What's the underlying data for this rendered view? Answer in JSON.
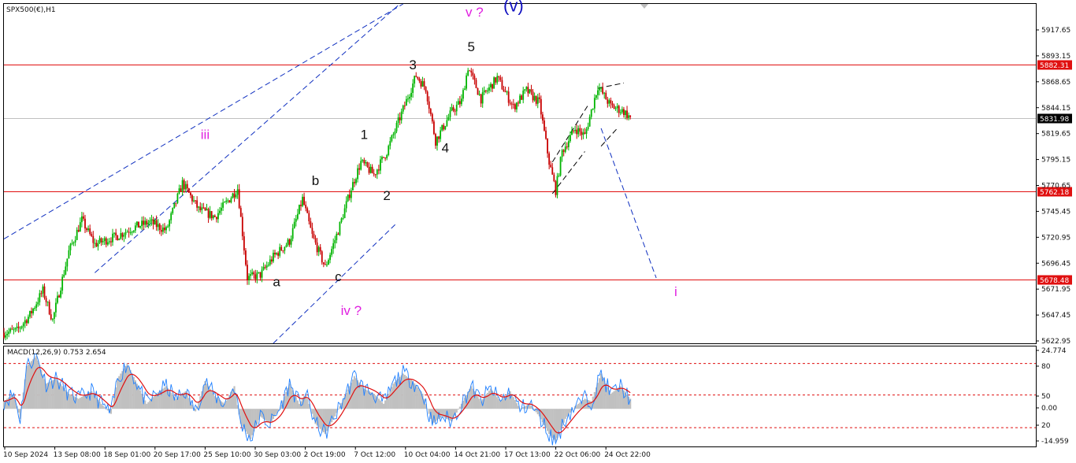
{
  "chart_data": [
    {
      "type": "candlestick",
      "title": "SPX500(€),H1",
      "y_ticks": [
        "5917.65",
        "5893.15",
        "5868.65",
        "5844.15",
        "5819.65",
        "5795.15",
        "5770.65",
        "5745.45",
        "5720.95",
        "5696.45",
        "5671.95",
        "5647.45",
        "5622.95"
      ],
      "ylim": [
        5618.0,
        5940.0
      ],
      "x_ticks": [
        "10 Sep 2024",
        "13 Sep 08:00",
        "18 Sep 01:00",
        "20 Sep 17:00",
        "25 Sep 10:00",
        "30 Sep 03:00",
        "2 Oct 19:00",
        "7 Oct 12:00",
        "10 Oct 04:00",
        "14 Oct 21:00",
        "17 Oct 13:00",
        "22 Oct 06:00",
        "24 Oct 22:00"
      ],
      "horizontal_levels": [
        {
          "value": 5882.31,
          "label": "5882.31",
          "color": "#e01010",
          "style": "solid"
        },
        {
          "value": 5762.18,
          "label": "5762.18",
          "color": "#e01010",
          "style": "solid"
        },
        {
          "value": 5678.48,
          "label": "5678.48",
          "color": "#e01010",
          "style": "solid"
        }
      ],
      "current_price": {
        "value": 5831.98,
        "label": "5831.98"
      },
      "price_path": [
        {
          "t": 0,
          "p": 5628
        },
        {
          "t": 4,
          "p": 5630
        },
        {
          "t": 8,
          "p": 5645
        },
        {
          "t": 12,
          "p": 5668
        },
        {
          "t": 15,
          "p": 5640
        },
        {
          "t": 20,
          "p": 5705
        },
        {
          "t": 24,
          "p": 5735
        },
        {
          "t": 28,
          "p": 5712
        },
        {
          "t": 35,
          "p": 5720
        },
        {
          "t": 40,
          "p": 5728
        },
        {
          "t": 45,
          "p": 5733
        },
        {
          "t": 50,
          "p": 5725
        },
        {
          "t": 55,
          "p": 5770
        },
        {
          "t": 60,
          "p": 5745
        },
        {
          "t": 65,
          "p": 5738
        },
        {
          "t": 70,
          "p": 5757
        },
        {
          "t": 72,
          "p": 5765
        },
        {
          "t": 75,
          "p": 5680
        },
        {
          "t": 79,
          "p": 5683
        },
        {
          "t": 83,
          "p": 5700
        },
        {
          "t": 88,
          "p": 5715
        },
        {
          "t": 92,
          "p": 5755
        },
        {
          "t": 95,
          "p": 5720
        },
        {
          "t": 99,
          "p": 5690
        },
        {
          "t": 103,
          "p": 5725
        },
        {
          "t": 107,
          "p": 5765
        },
        {
          "t": 110,
          "p": 5790
        },
        {
          "t": 114,
          "p": 5778
        },
        {
          "t": 118,
          "p": 5800
        },
        {
          "t": 123,
          "p": 5840
        },
        {
          "t": 127,
          "p": 5872
        },
        {
          "t": 130,
          "p": 5860
        },
        {
          "t": 133,
          "p": 5810
        },
        {
          "t": 138,
          "p": 5838
        },
        {
          "t": 141,
          "p": 5848
        },
        {
          "t": 143,
          "p": 5880
        },
        {
          "t": 147,
          "p": 5850
        },
        {
          "t": 152,
          "p": 5870
        },
        {
          "t": 157,
          "p": 5842
        },
        {
          "t": 161,
          "p": 5858
        },
        {
          "t": 165,
          "p": 5846
        },
        {
          "t": 168,
          "p": 5790
        },
        {
          "t": 170,
          "p": 5763
        },
        {
          "t": 172,
          "p": 5800
        },
        {
          "t": 176,
          "p": 5822
        },
        {
          "t": 179,
          "p": 5815
        },
        {
          "t": 183,
          "p": 5862
        },
        {
          "t": 187,
          "p": 5843
        },
        {
          "t": 191,
          "p": 5838
        },
        {
          "t": 193,
          "p": 5832
        }
      ],
      "wave_labels": [
        {
          "text": "(v)",
          "color": "#1010c0",
          "t": 157,
          "p": 5933
        },
        {
          "text": "v ?",
          "color": "#e020e0",
          "t": 145,
          "p": 5928
        },
        {
          "text": "5",
          "color": "#111111",
          "t": 144,
          "p": 5895
        },
        {
          "text": "3",
          "color": "#111111",
          "t": 126,
          "p": 5878
        },
        {
          "text": "iii",
          "color": "#e020e0",
          "t": 62,
          "p": 5812
        },
        {
          "text": "1",
          "color": "#111111",
          "t": 111,
          "p": 5812
        },
        {
          "text": "4",
          "color": "#111111",
          "t": 136,
          "p": 5799
        },
        {
          "text": "b",
          "color": "#111111",
          "t": 96,
          "p": 5768
        },
        {
          "text": "2",
          "color": "#111111",
          "t": 118,
          "p": 5754
        },
        {
          "text": "a",
          "color": "#111111",
          "t": 84,
          "p": 5672
        },
        {
          "text": "c",
          "color": "#111111",
          "t": 103,
          "p": 5677
        },
        {
          "text": "iv ?",
          "color": "#e020e0",
          "t": 107,
          "p": 5645
        },
        {
          "text": "i",
          "color": "#e020e0",
          "t": 207,
          "p": 5663
        }
      ],
      "trend_lines": [
        {
          "from": {
            "t": 0,
            "p": 5717
          },
          "to": {
            "t": 123,
            "p": 5940
          },
          "color": "#1030c0",
          "style": "dashed"
        },
        {
          "from": {
            "t": 28,
            "p": 5685
          },
          "to": {
            "t": 122,
            "p": 5940
          },
          "color": "#1030c0",
          "style": "dashed"
        },
        {
          "from": {
            "t": 83,
            "p": 5618
          },
          "to": {
            "t": 121,
            "p": 5732
          },
          "color": "#1030c0",
          "style": "dashed"
        },
        {
          "from": {
            "t": 169,
            "p": 5760
          },
          "to": {
            "t": 179,
            "p": 5800
          },
          "color": "#000000",
          "style": "dashed"
        },
        {
          "from": {
            "t": 169,
            "p": 5790
          },
          "to": {
            "t": 180,
            "p": 5844
          },
          "color": "#000000",
          "style": "dashed"
        },
        {
          "from": {
            "t": 183,
            "p": 5860
          },
          "to": {
            "t": 191,
            "p": 5865
          },
          "color": "#000000",
          "style": "dashed"
        },
        {
          "from": {
            "t": 184,
            "p": 5805
          },
          "to": {
            "t": 189,
            "p": 5822
          },
          "color": "#000000",
          "style": "dashed"
        },
        {
          "from": {
            "t": 184,
            "p": 5822
          },
          "to": {
            "t": 201,
            "p": 5680
          },
          "color": "#1030c0",
          "style": "dashed"
        }
      ],
      "bull_color": "#00b400",
      "bear_color": "#c80000"
    },
    {
      "type": "macd",
      "title": "MACD(12,26,9) 0.753 2.654",
      "y_ticks": [
        "24.774",
        "80",
        "50",
        "0.00",
        "20",
        "-14.959"
      ],
      "ylim": [
        -14.959,
        24.774
      ],
      "dashed_levels": [
        18,
        5.5,
        -7.5
      ],
      "histogram_color": "#c0c0c0",
      "main_line_color": "#2080ff",
      "signal_line_color": "#e01010",
      "macd_path": [
        {
          "t": 0,
          "v": 3
        },
        {
          "t": 3,
          "v": 6
        },
        {
          "t": 5,
          "v": -4
        },
        {
          "t": 7,
          "v": 17
        },
        {
          "t": 10,
          "v": 21
        },
        {
          "t": 13,
          "v": 10
        },
        {
          "t": 16,
          "v": 12
        },
        {
          "t": 20,
          "v": 6
        },
        {
          "t": 23,
          "v": 4
        },
        {
          "t": 27,
          "v": 7
        },
        {
          "t": 30,
          "v": 2
        },
        {
          "t": 33,
          "v": -2
        },
        {
          "t": 35,
          "v": 12
        },
        {
          "t": 38,
          "v": 18
        },
        {
          "t": 41,
          "v": 10
        },
        {
          "t": 44,
          "v": 2
        },
        {
          "t": 47,
          "v": 6
        },
        {
          "t": 50,
          "v": 9
        },
        {
          "t": 53,
          "v": 4
        },
        {
          "t": 56,
          "v": 7
        },
        {
          "t": 59,
          "v": -1
        },
        {
          "t": 62,
          "v": 11
        },
        {
          "t": 65,
          "v": 5
        },
        {
          "t": 68,
          "v": 2
        },
        {
          "t": 71,
          "v": 9
        },
        {
          "t": 73,
          "v": -6
        },
        {
          "t": 76,
          "v": -12
        },
        {
          "t": 79,
          "v": -3
        },
        {
          "t": 82,
          "v": -6
        },
        {
          "t": 85,
          "v": 0
        },
        {
          "t": 88,
          "v": 10
        },
        {
          "t": 91,
          "v": 2
        },
        {
          "t": 93,
          "v": 6
        },
        {
          "t": 96,
          "v": -6
        },
        {
          "t": 99,
          "v": -10
        },
        {
          "t": 102,
          "v": -3
        },
        {
          "t": 105,
          "v": 5
        },
        {
          "t": 108,
          "v": 13
        },
        {
          "t": 111,
          "v": 8
        },
        {
          "t": 114,
          "v": 6
        },
        {
          "t": 117,
          "v": 2
        },
        {
          "t": 120,
          "v": 10
        },
        {
          "t": 123,
          "v": 14
        },
        {
          "t": 126,
          "v": 11
        },
        {
          "t": 129,
          "v": 6
        },
        {
          "t": 132,
          "v": -6
        },
        {
          "t": 135,
          "v": -3
        },
        {
          "t": 138,
          "v": -5
        },
        {
          "t": 141,
          "v": 2
        },
        {
          "t": 144,
          "v": 9
        },
        {
          "t": 147,
          "v": 3
        },
        {
          "t": 150,
          "v": 8
        },
        {
          "t": 153,
          "v": 3
        },
        {
          "t": 156,
          "v": 7
        },
        {
          "t": 159,
          "v": 0
        },
        {
          "t": 162,
          "v": 2
        },
        {
          "t": 165,
          "v": -3
        },
        {
          "t": 168,
          "v": -10
        },
        {
          "t": 170,
          "v": -13
        },
        {
          "t": 173,
          "v": -4
        },
        {
          "t": 176,
          "v": 1
        },
        {
          "t": 179,
          "v": 4
        },
        {
          "t": 181,
          "v": 3
        },
        {
          "t": 184,
          "v": 14
        },
        {
          "t": 187,
          "v": 6
        },
        {
          "t": 190,
          "v": 9
        },
        {
          "t": 193,
          "v": 4
        }
      ]
    }
  ]
}
